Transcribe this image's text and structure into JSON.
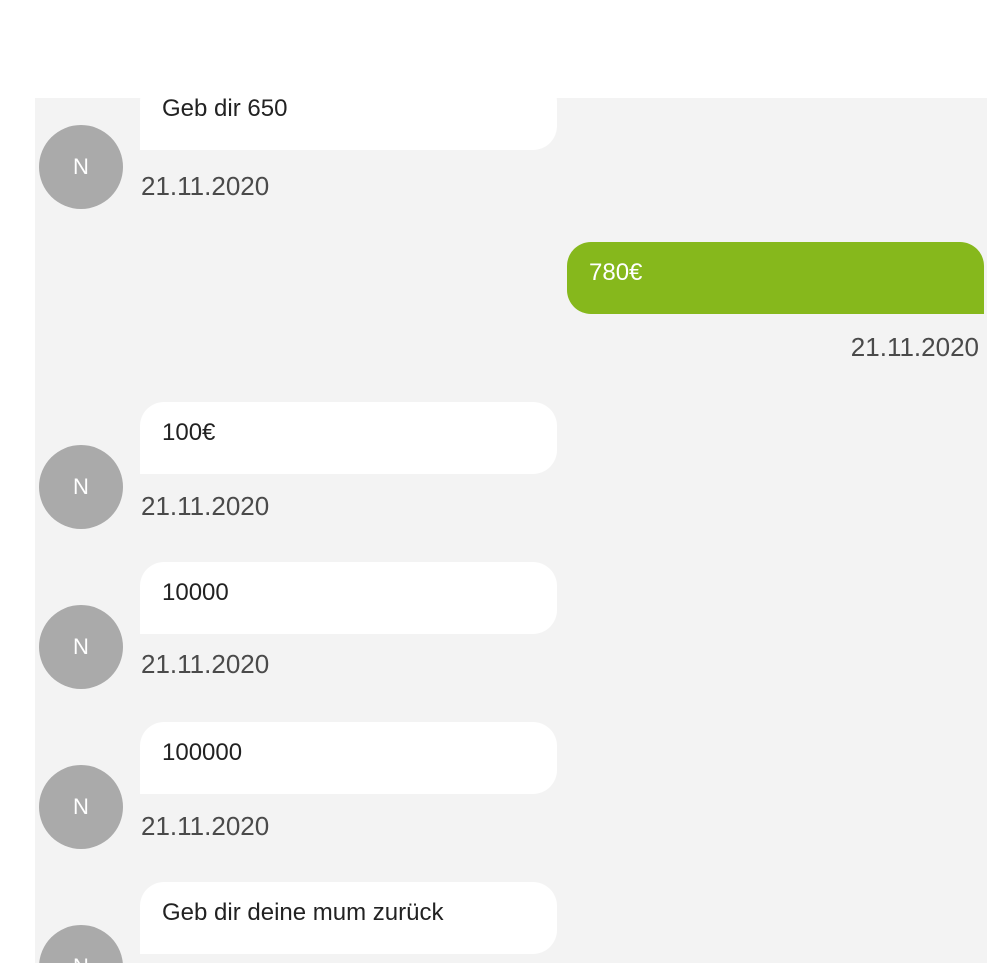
{
  "messages": [
    {
      "direction": "incoming",
      "text": "Geb dir 650",
      "time": "21.11.2020",
      "avatar": "N"
    },
    {
      "direction": "outgoing",
      "text": "780€",
      "time": "21.11.2020"
    },
    {
      "direction": "incoming",
      "text": "100€",
      "time": "21.11.2020",
      "avatar": "N"
    },
    {
      "direction": "incoming",
      "text": "10000",
      "time": "21.11.2020",
      "avatar": "N"
    },
    {
      "direction": "incoming",
      "text": "100000",
      "time": "21.11.2020",
      "avatar": "N"
    },
    {
      "direction": "incoming",
      "text": "Geb dir deine mum zurück",
      "avatar": "N"
    }
  ],
  "colors": {
    "outgoing_bubble": "#86b81c",
    "incoming_bubble": "#ffffff",
    "avatar": "#aaaaaa",
    "chat_background": "#f3f3f3"
  }
}
